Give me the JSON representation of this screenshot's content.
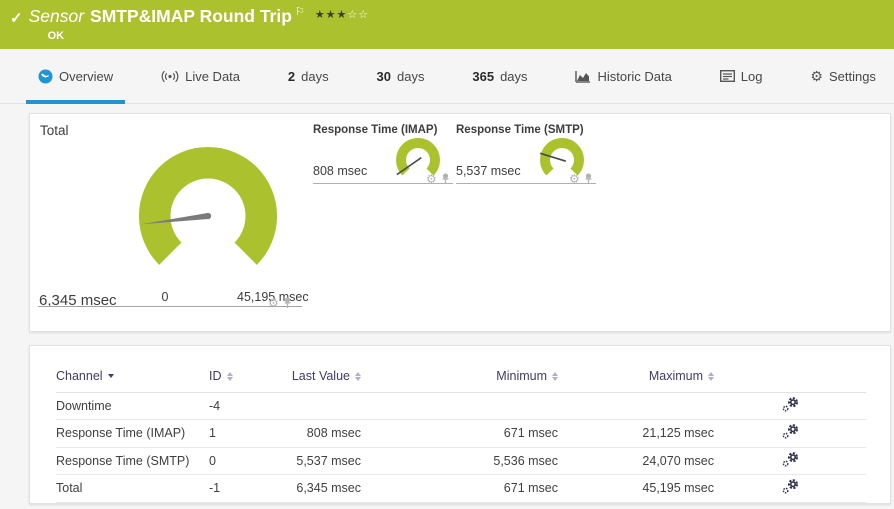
{
  "colors": {
    "green": "#abc22e",
    "blue": "#2095d2",
    "header_text": "#413b66"
  },
  "header": {
    "check_icon": "✓",
    "type_label": "Sensor",
    "title": "SMTP&IMAP Round Trip",
    "flag_icon": "⚐",
    "status": "OK",
    "rating": {
      "filled": 3,
      "total": 5
    },
    "stars_filled": "★★★",
    "stars_empty": "☆☆"
  },
  "tabs": [
    {
      "id": "overview",
      "label": "Overview",
      "active": true
    },
    {
      "id": "live-data",
      "label": "Live Data"
    },
    {
      "id": "2-days",
      "num": "2",
      "label": "days"
    },
    {
      "id": "30-days",
      "num": "30",
      "label": "days"
    },
    {
      "id": "365-days",
      "num": "365",
      "label": "days"
    },
    {
      "id": "historic-data",
      "label": "Historic Data"
    },
    {
      "id": "log",
      "label": "Log"
    },
    {
      "id": "settings",
      "label": "Settings"
    }
  ],
  "gauges": {
    "main": {
      "title": "Total",
      "value": 6345,
      "value_label": "6,345 msec",
      "scale_min_label": "0",
      "scale_max_label": "45,195 msec",
      "min": 0,
      "max": 45195
    },
    "small": [
      {
        "title": "Response Time (IMAP)",
        "value": 808,
        "value_label": "808 msec",
        "max": 21125
      },
      {
        "title": "Response Time (SMTP)",
        "value": 5537,
        "value_label": "5,537 msec",
        "max": 24070
      }
    ]
  },
  "table": {
    "columns": [
      {
        "label": "Channel",
        "sorted": "desc"
      },
      {
        "label": "ID"
      },
      {
        "label": "Last Value"
      },
      {
        "label": "Minimum"
      },
      {
        "label": "Maximum"
      }
    ],
    "rows": [
      {
        "channel": "Downtime",
        "id": "-4",
        "last_value": "",
        "minimum": "",
        "maximum": ""
      },
      {
        "channel": "Response Time (IMAP)",
        "id": "1",
        "last_value": "808 msec",
        "minimum": "671 msec",
        "maximum": "21,125 msec"
      },
      {
        "channel": "Response Time (SMTP)",
        "id": "0",
        "last_value": "5,537 msec",
        "minimum": "5,536 msec",
        "maximum": "24,070 msec"
      },
      {
        "channel": "Total",
        "id": "-1",
        "last_value": "6,345 msec",
        "minimum": "671 msec",
        "maximum": "45,195 msec"
      }
    ]
  }
}
